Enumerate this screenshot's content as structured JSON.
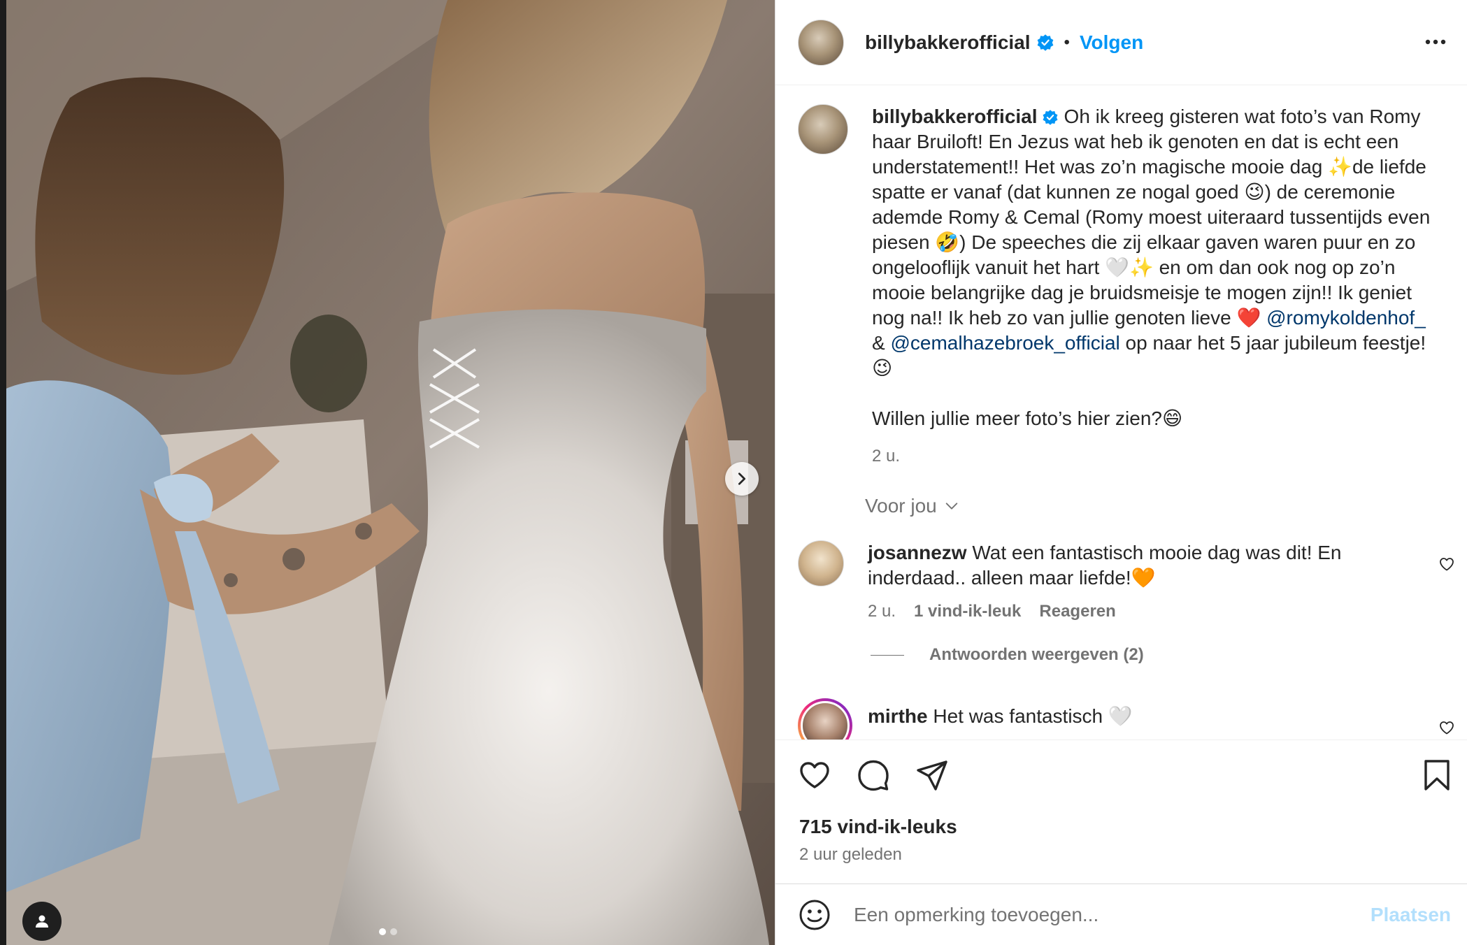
{
  "header": {
    "username": "billybakkerofficial",
    "separator": "•",
    "follow_label": "Volgen"
  },
  "caption": {
    "username": "billybakkerofficial",
    "text": "Oh ik kreeg gisteren wat foto’s van Romy haar Bruiloft! En Jezus wat heb ik genoten en dat is echt een understatement!! Het was zo’n magische mooie dag ✨de liefde spatte er vanaf (dat kunnen ze nogal goed 😉) de ceremonie ademde Romy & Cemal (Romy moest uiteraard tussentijds even piesen 🤣) De speeches die zij elkaar gaven waren puur en zo ongelooflijk vanuit het hart 🤍✨ en om dan ook nog op zo’n mooie belangrijke dag je bruidsmeisje te mogen zijn!! Ik geniet nog na!! Ik heb zo van jullie genoten lieve ❤️ ",
    "mention1": "@romykoldenhof_",
    "amp": " & ",
    "mention2": "@cemalhazebroek_official",
    "text_end": " op naar het 5 jaar jubileum feestje! 😉",
    "question": "Willen jullie meer foto’s hier zien?😄",
    "time": "2 u."
  },
  "filter": {
    "label": "Voor jou"
  },
  "comments": [
    {
      "username": "josannezw",
      "text": "Wat een fantastisch mooie dag was dit! En inderdaad.. alleen maar liefde!🧡",
      "time": "2 u.",
      "likes": "1 vind-ik-leuk",
      "reply": "Reageren",
      "view_replies": "Antwoorden weergeven (2)"
    },
    {
      "username": "mirthe",
      "text": "Het was fantastisch 🤍"
    }
  ],
  "stats": {
    "likes": "715 vind-ik-leuks",
    "posted": "2 uur geleden"
  },
  "add_comment": {
    "placeholder": "Een opmerking toevoegen...",
    "post_label": "Plaatsen"
  },
  "carousel": {
    "current": 1,
    "total": 2
  },
  "colors": {
    "link": "#0095f6",
    "mention": "#00376b",
    "verified": "#0095f6",
    "muted": "#737373"
  }
}
